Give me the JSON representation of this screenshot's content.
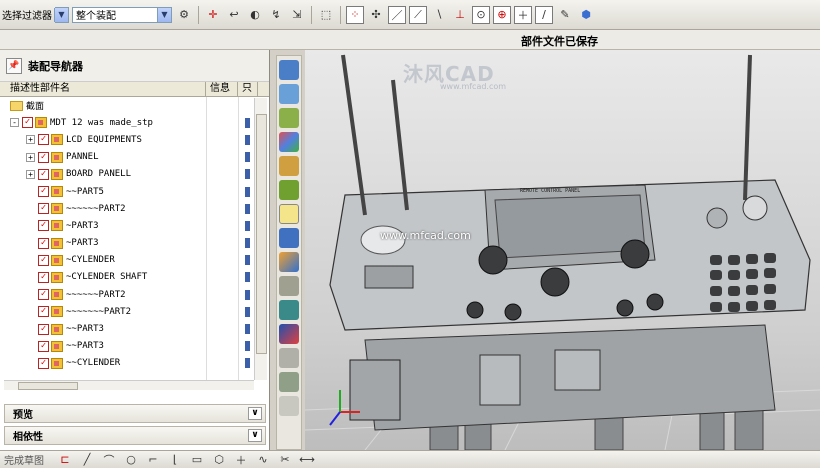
{
  "toolbar": {
    "filter_label": "选择过滤器",
    "scope_value": "整个装配",
    "icons": [
      "filter-icon",
      "snap-icon",
      "select-icon",
      "point-icon",
      "line-icon",
      "circle-icon",
      "plus-icon",
      "cube-icon"
    ]
  },
  "status": {
    "message": "部件文件已保存"
  },
  "navigator": {
    "title": "装配导航器",
    "columns": [
      "描述性部件名",
      "信息",
      "只"
    ],
    "rows": [
      {
        "name": "截面",
        "type": "folder",
        "level": 0,
        "expander": ""
      },
      {
        "name": "MDT 12 was made_stp",
        "type": "assembly",
        "level": 0,
        "expander": "-"
      },
      {
        "name": "LCD EQUIPMENTS",
        "type": "assembly",
        "level": 1,
        "expander": "+"
      },
      {
        "name": "PANNEL",
        "type": "assembly",
        "level": 1,
        "expander": "+"
      },
      {
        "name": "BOARD PANELL",
        "type": "assembly",
        "level": 1,
        "expander": "+"
      },
      {
        "name": "~~PART5",
        "type": "part",
        "level": 1,
        "expander": ""
      },
      {
        "name": "~~~~~~PART2",
        "type": "part",
        "level": 1,
        "expander": ""
      },
      {
        "name": "~PART3",
        "type": "part",
        "level": 1,
        "expander": ""
      },
      {
        "name": "~PART3",
        "type": "part",
        "level": 1,
        "expander": ""
      },
      {
        "name": "~CYLENDER",
        "type": "part",
        "level": 1,
        "expander": ""
      },
      {
        "name": "~CYLENDER SHAFT",
        "type": "part",
        "level": 1,
        "expander": ""
      },
      {
        "name": "~~~~~~PART2",
        "type": "part",
        "level": 1,
        "expander": ""
      },
      {
        "name": "~~~~~~~PART2",
        "type": "part",
        "level": 1,
        "expander": ""
      },
      {
        "name": "~~PART3",
        "type": "part",
        "level": 1,
        "expander": ""
      },
      {
        "name": "~~PART3",
        "type": "part",
        "level": 1,
        "expander": ""
      },
      {
        "name": "~~CYLENDER",
        "type": "part",
        "level": 1,
        "expander": ""
      }
    ],
    "panels": [
      "预览",
      "相依性"
    ]
  },
  "viewport": {
    "watermark": "沐风CAD",
    "watermark_sub": "www.mfcad.com",
    "url": "www.mfcad.com",
    "panel_text": "REMOTE CONTROL PANEL"
  },
  "bottom": {
    "label": "完成草图"
  }
}
